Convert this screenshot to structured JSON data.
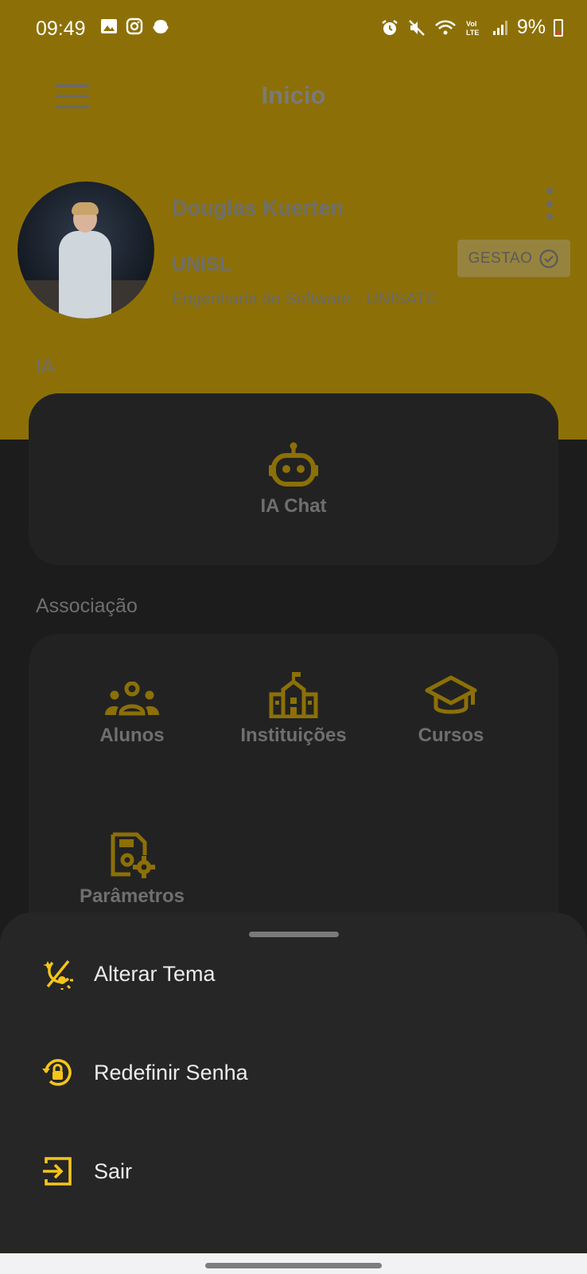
{
  "status_bar": {
    "time": "09:49",
    "battery": "9%"
  },
  "header": {
    "title": "Inicio"
  },
  "profile": {
    "name": "Douglas Kuerten",
    "institution": "UNISL",
    "course": "Engenharia de Software - UNISATC",
    "role_chip": "GESTAO"
  },
  "sections": {
    "ia": {
      "label": "IA",
      "items": [
        {
          "label": "IA Chat",
          "icon": "robot-icon"
        }
      ]
    },
    "associacao": {
      "label": "Associação",
      "items": [
        {
          "label": "Alunos",
          "icon": "group-icon"
        },
        {
          "label": "Instituições",
          "icon": "school-building-icon"
        },
        {
          "label": "Cursos",
          "icon": "graduation-cap-icon"
        },
        {
          "label": "Parâmetros",
          "icon": "settings-document-icon"
        }
      ]
    }
  },
  "bottom_sheet": {
    "items": [
      {
        "label": "Alterar Tema",
        "icon": "theme-toggle-icon"
      },
      {
        "label": "Redefinir Senha",
        "icon": "lock-reset-icon"
      },
      {
        "label": "Sair",
        "icon": "logout-icon"
      }
    ]
  },
  "colors": {
    "accent": "#f5c518",
    "accent_dimmed": "#8c7007",
    "background": "#1c1c1c",
    "card": "#222222",
    "sheet": "#262626"
  }
}
